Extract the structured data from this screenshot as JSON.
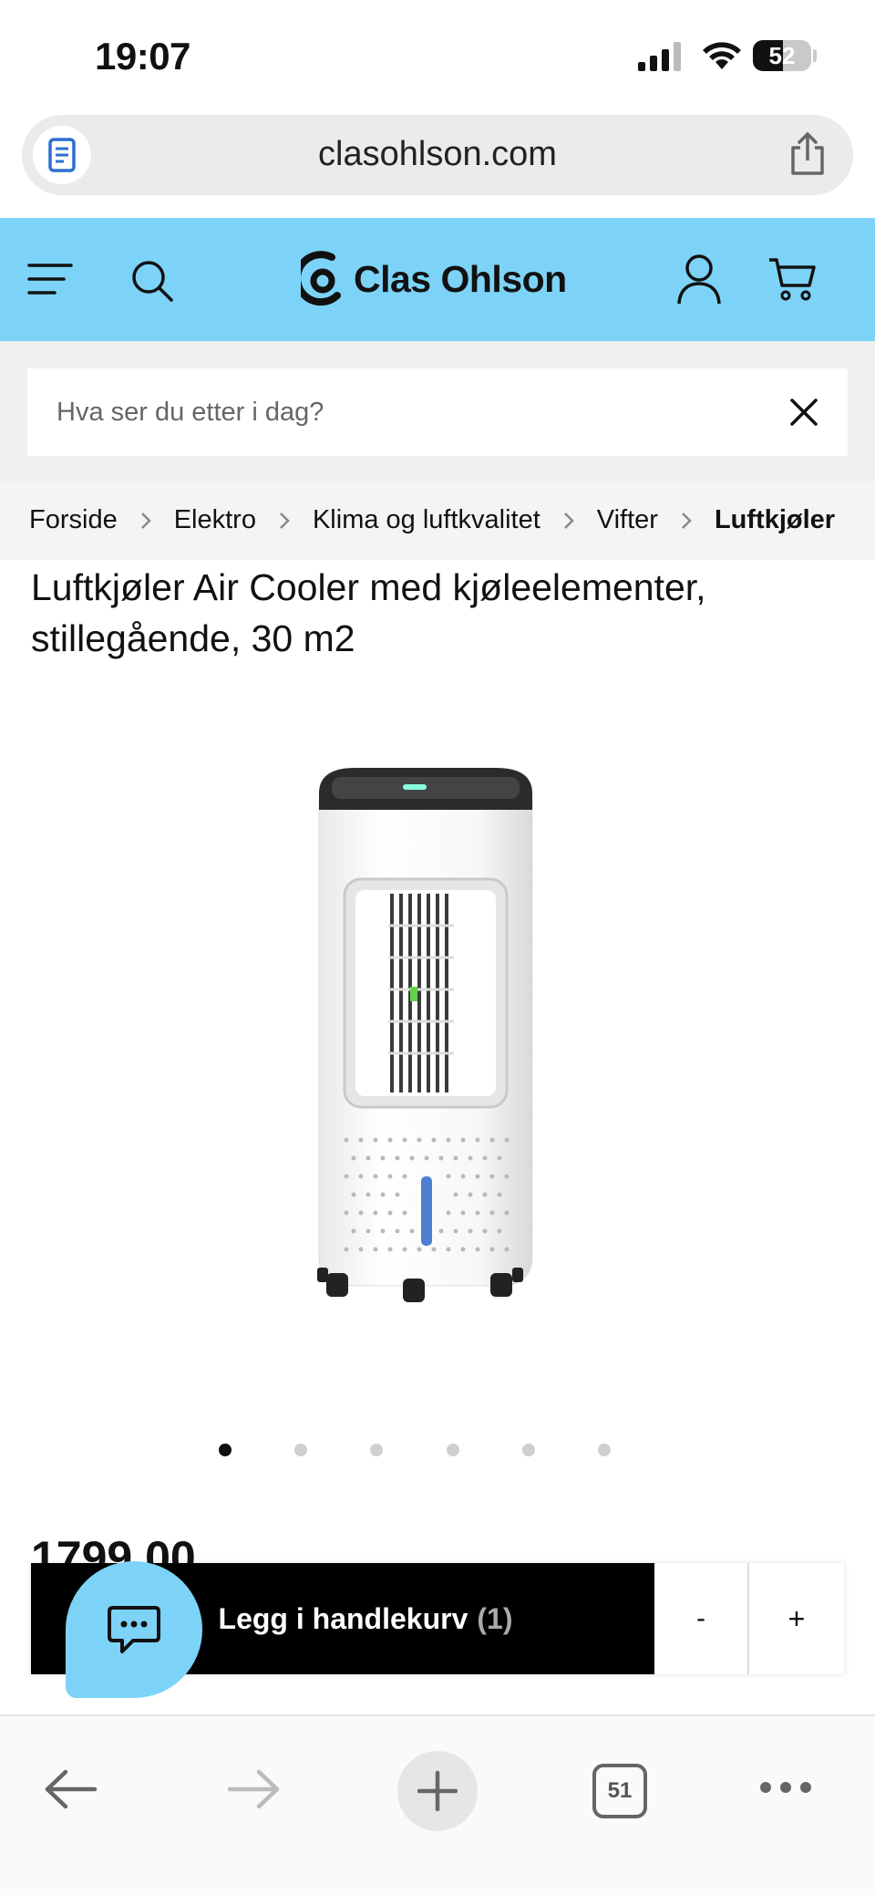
{
  "status_bar": {
    "time": "19:07",
    "battery": "52",
    "icons": [
      "signal-icon",
      "wifi-icon",
      "battery-icon"
    ]
  },
  "browser": {
    "url": "clasohlson.com",
    "tab_count": "51",
    "icons": [
      "reader-icon",
      "share-icon",
      "back-arrow-icon",
      "forward-arrow-icon",
      "plus-icon",
      "tabs-icon",
      "more-icon"
    ]
  },
  "header": {
    "logo_text": "Clas Ohlson",
    "background": "#7dd3f7",
    "icons": [
      "menu-icon",
      "search-icon",
      "account-icon",
      "cart-icon"
    ]
  },
  "search": {
    "placeholder": "Hva ser du etter i dag?",
    "value": ""
  },
  "breadcrumb": {
    "items": [
      "Forside",
      "Elektro",
      "Klima og luftkvalitet",
      "Vifter"
    ],
    "current": "Luftkjøler"
  },
  "product": {
    "title": "Luftkjøler Air Cooler med kjøleelementer, stillegående, 30 m2",
    "price": "1799,00",
    "image_count": 6,
    "active_image": 1
  },
  "cart_bar": {
    "add_label": "Legg i handlekurv",
    "quantity_label": "(1)",
    "minus_label": "-",
    "plus_label": "+"
  },
  "chat": {
    "icon": "chat-icon",
    "accent": "#7dd3f7"
  }
}
